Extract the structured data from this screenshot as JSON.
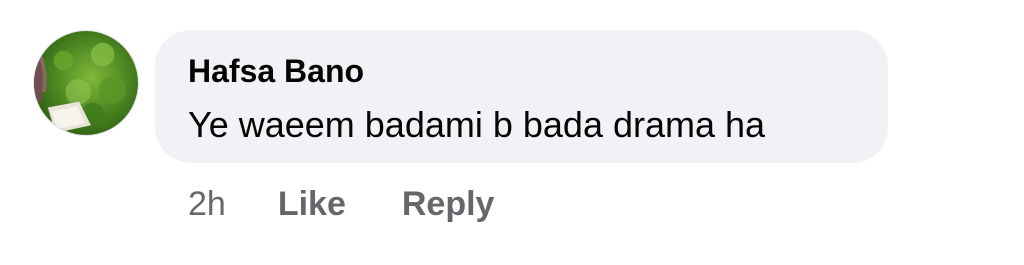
{
  "comment": {
    "author": "Hafsa Bano",
    "text": "Ye waeem badami b bada drama ha",
    "timestamp": "2h",
    "like_label": "Like",
    "reply_label": "Reply",
    "avatar_icon": "profile-photo-grass"
  },
  "colors": {
    "bubble_background": "#f0f2f5",
    "author_text": "#050505",
    "secondary_text": "#65676b"
  }
}
